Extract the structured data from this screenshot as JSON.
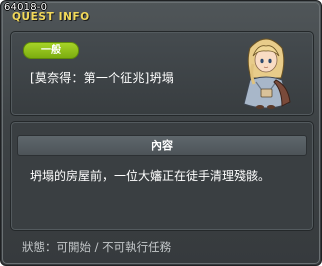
{
  "window": {
    "quest_code": "64018-0",
    "title": "QUEST INFO"
  },
  "quest": {
    "category_badge": "一般",
    "name": "[莫奈得：第一个征兆]坍塌",
    "portrait_icon": "npc-portrait-blonde-girl"
  },
  "content": {
    "header": "內容",
    "description": "坍塌的房屋前，一位大嬸正在徒手清理殘骸。"
  },
  "status": {
    "text": "狀態：可開始 / 不可執行任務"
  },
  "colors": {
    "title": "#f2d95a",
    "badge": "#8dbd18",
    "panel": "#3a3f42",
    "window": "#44494c"
  }
}
